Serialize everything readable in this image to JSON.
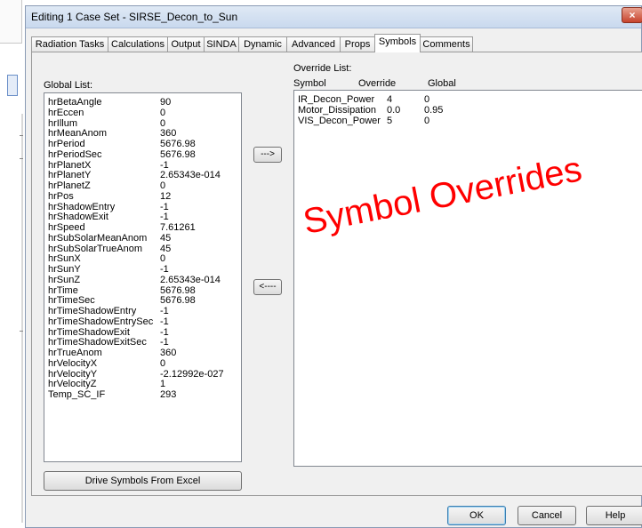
{
  "window": {
    "title": "Editing 1 Case Set - SIRSE_Decon_to_Sun",
    "close_glyph": "×"
  },
  "tabs": [
    "Radiation Tasks",
    "Calculations",
    "Output",
    "SINDA",
    "Dynamic",
    "Advanced",
    "Props",
    "Symbols",
    "Comments"
  ],
  "active_tab": "Symbols",
  "global_list": {
    "label": "Global List:",
    "items": [
      {
        "name": "hrBetaAngle",
        "value": "90"
      },
      {
        "name": "hrEccen",
        "value": "0"
      },
      {
        "name": "hrIllum",
        "value": "0"
      },
      {
        "name": "hrMeanAnom",
        "value": "360"
      },
      {
        "name": "hrPeriod",
        "value": "5676.98"
      },
      {
        "name": "hrPeriodSec",
        "value": "5676.98"
      },
      {
        "name": "hrPlanetX",
        "value": "-1"
      },
      {
        "name": "hrPlanetY",
        "value": "2.65343e-014"
      },
      {
        "name": "hrPlanetZ",
        "value": "0"
      },
      {
        "name": "hrPos",
        "value": "12"
      },
      {
        "name": "hrShadowEntry",
        "value": "-1"
      },
      {
        "name": "hrShadowExit",
        "value": "-1"
      },
      {
        "name": "hrSpeed",
        "value": "7.61261"
      },
      {
        "name": "hrSubSolarMeanAnom",
        "value": "45"
      },
      {
        "name": "hrSubSolarTrueAnom",
        "value": "45"
      },
      {
        "name": "hrSunX",
        "value": "0"
      },
      {
        "name": "hrSunY",
        "value": "-1"
      },
      {
        "name": "hrSunZ",
        "value": "2.65343e-014"
      },
      {
        "name": "hrTime",
        "value": "5676.98"
      },
      {
        "name": "hrTimeSec",
        "value": "5676.98"
      },
      {
        "name": "hrTimeShadowEntry",
        "value": "-1"
      },
      {
        "name": "hrTimeShadowEntrySec",
        "value": "-1"
      },
      {
        "name": "hrTimeShadowExit",
        "value": "-1"
      },
      {
        "name": "hrTimeShadowExitSec",
        "value": "-1"
      },
      {
        "name": "hrTrueAnom",
        "value": "360"
      },
      {
        "name": "hrVelocityX",
        "value": "0"
      },
      {
        "name": "hrVelocityY",
        "value": "-2.12992e-027"
      },
      {
        "name": "hrVelocityZ",
        "value": "1"
      },
      {
        "name": "Temp_SC_IF",
        "value": "293"
      }
    ]
  },
  "override_list": {
    "label": "Override List:",
    "headers": {
      "symbol": "Symbol",
      "override": "Override",
      "global": "Global"
    },
    "items": [
      {
        "symbol": "IR_Decon_Power",
        "override": "4",
        "global": "0"
      },
      {
        "symbol": "Motor_Dissipation",
        "override": "0.0",
        "global": "0.95"
      },
      {
        "symbol": "VIS_Decon_Power",
        "override": "5",
        "global": "0"
      }
    ]
  },
  "buttons": {
    "add_override": "--->",
    "remove_override": "<----",
    "drive_excel": "Drive Symbols From Excel",
    "ok": "OK",
    "cancel": "Cancel",
    "help": "Help"
  },
  "annotation": {
    "text": "Symbol Overrides",
    "color": "#ff0000"
  }
}
